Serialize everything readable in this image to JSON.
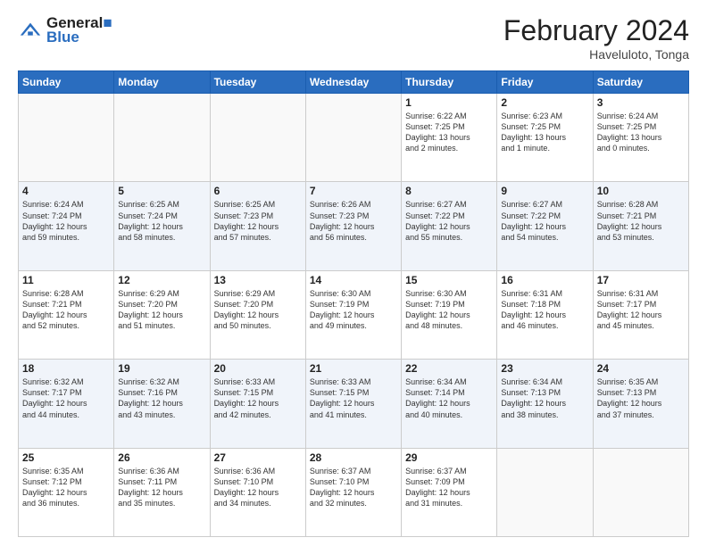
{
  "header": {
    "logo_line1": "General",
    "logo_line2": "Blue",
    "month_title": "February 2024",
    "location": "Haveluloto, Tonga"
  },
  "days_of_week": [
    "Sunday",
    "Monday",
    "Tuesday",
    "Wednesday",
    "Thursday",
    "Friday",
    "Saturday"
  ],
  "weeks": [
    [
      {
        "num": "",
        "info": ""
      },
      {
        "num": "",
        "info": ""
      },
      {
        "num": "",
        "info": ""
      },
      {
        "num": "",
        "info": ""
      },
      {
        "num": "1",
        "info": "Sunrise: 6:22 AM\nSunset: 7:25 PM\nDaylight: 13 hours\nand 2 minutes."
      },
      {
        "num": "2",
        "info": "Sunrise: 6:23 AM\nSunset: 7:25 PM\nDaylight: 13 hours\nand 1 minute."
      },
      {
        "num": "3",
        "info": "Sunrise: 6:24 AM\nSunset: 7:25 PM\nDaylight: 13 hours\nand 0 minutes."
      }
    ],
    [
      {
        "num": "4",
        "info": "Sunrise: 6:24 AM\nSunset: 7:24 PM\nDaylight: 12 hours\nand 59 minutes."
      },
      {
        "num": "5",
        "info": "Sunrise: 6:25 AM\nSunset: 7:24 PM\nDaylight: 12 hours\nand 58 minutes."
      },
      {
        "num": "6",
        "info": "Sunrise: 6:25 AM\nSunset: 7:23 PM\nDaylight: 12 hours\nand 57 minutes."
      },
      {
        "num": "7",
        "info": "Sunrise: 6:26 AM\nSunset: 7:23 PM\nDaylight: 12 hours\nand 56 minutes."
      },
      {
        "num": "8",
        "info": "Sunrise: 6:27 AM\nSunset: 7:22 PM\nDaylight: 12 hours\nand 55 minutes."
      },
      {
        "num": "9",
        "info": "Sunrise: 6:27 AM\nSunset: 7:22 PM\nDaylight: 12 hours\nand 54 minutes."
      },
      {
        "num": "10",
        "info": "Sunrise: 6:28 AM\nSunset: 7:21 PM\nDaylight: 12 hours\nand 53 minutes."
      }
    ],
    [
      {
        "num": "11",
        "info": "Sunrise: 6:28 AM\nSunset: 7:21 PM\nDaylight: 12 hours\nand 52 minutes."
      },
      {
        "num": "12",
        "info": "Sunrise: 6:29 AM\nSunset: 7:20 PM\nDaylight: 12 hours\nand 51 minutes."
      },
      {
        "num": "13",
        "info": "Sunrise: 6:29 AM\nSunset: 7:20 PM\nDaylight: 12 hours\nand 50 minutes."
      },
      {
        "num": "14",
        "info": "Sunrise: 6:30 AM\nSunset: 7:19 PM\nDaylight: 12 hours\nand 49 minutes."
      },
      {
        "num": "15",
        "info": "Sunrise: 6:30 AM\nSunset: 7:19 PM\nDaylight: 12 hours\nand 48 minutes."
      },
      {
        "num": "16",
        "info": "Sunrise: 6:31 AM\nSunset: 7:18 PM\nDaylight: 12 hours\nand 46 minutes."
      },
      {
        "num": "17",
        "info": "Sunrise: 6:31 AM\nSunset: 7:17 PM\nDaylight: 12 hours\nand 45 minutes."
      }
    ],
    [
      {
        "num": "18",
        "info": "Sunrise: 6:32 AM\nSunset: 7:17 PM\nDaylight: 12 hours\nand 44 minutes."
      },
      {
        "num": "19",
        "info": "Sunrise: 6:32 AM\nSunset: 7:16 PM\nDaylight: 12 hours\nand 43 minutes."
      },
      {
        "num": "20",
        "info": "Sunrise: 6:33 AM\nSunset: 7:15 PM\nDaylight: 12 hours\nand 42 minutes."
      },
      {
        "num": "21",
        "info": "Sunrise: 6:33 AM\nSunset: 7:15 PM\nDaylight: 12 hours\nand 41 minutes."
      },
      {
        "num": "22",
        "info": "Sunrise: 6:34 AM\nSunset: 7:14 PM\nDaylight: 12 hours\nand 40 minutes."
      },
      {
        "num": "23",
        "info": "Sunrise: 6:34 AM\nSunset: 7:13 PM\nDaylight: 12 hours\nand 38 minutes."
      },
      {
        "num": "24",
        "info": "Sunrise: 6:35 AM\nSunset: 7:13 PM\nDaylight: 12 hours\nand 37 minutes."
      }
    ],
    [
      {
        "num": "25",
        "info": "Sunrise: 6:35 AM\nSunset: 7:12 PM\nDaylight: 12 hours\nand 36 minutes."
      },
      {
        "num": "26",
        "info": "Sunrise: 6:36 AM\nSunset: 7:11 PM\nDaylight: 12 hours\nand 35 minutes."
      },
      {
        "num": "27",
        "info": "Sunrise: 6:36 AM\nSunset: 7:10 PM\nDaylight: 12 hours\nand 34 minutes."
      },
      {
        "num": "28",
        "info": "Sunrise: 6:37 AM\nSunset: 7:10 PM\nDaylight: 12 hours\nand 32 minutes."
      },
      {
        "num": "29",
        "info": "Sunrise: 6:37 AM\nSunset: 7:09 PM\nDaylight: 12 hours\nand 31 minutes."
      },
      {
        "num": "",
        "info": ""
      },
      {
        "num": "",
        "info": ""
      }
    ]
  ]
}
